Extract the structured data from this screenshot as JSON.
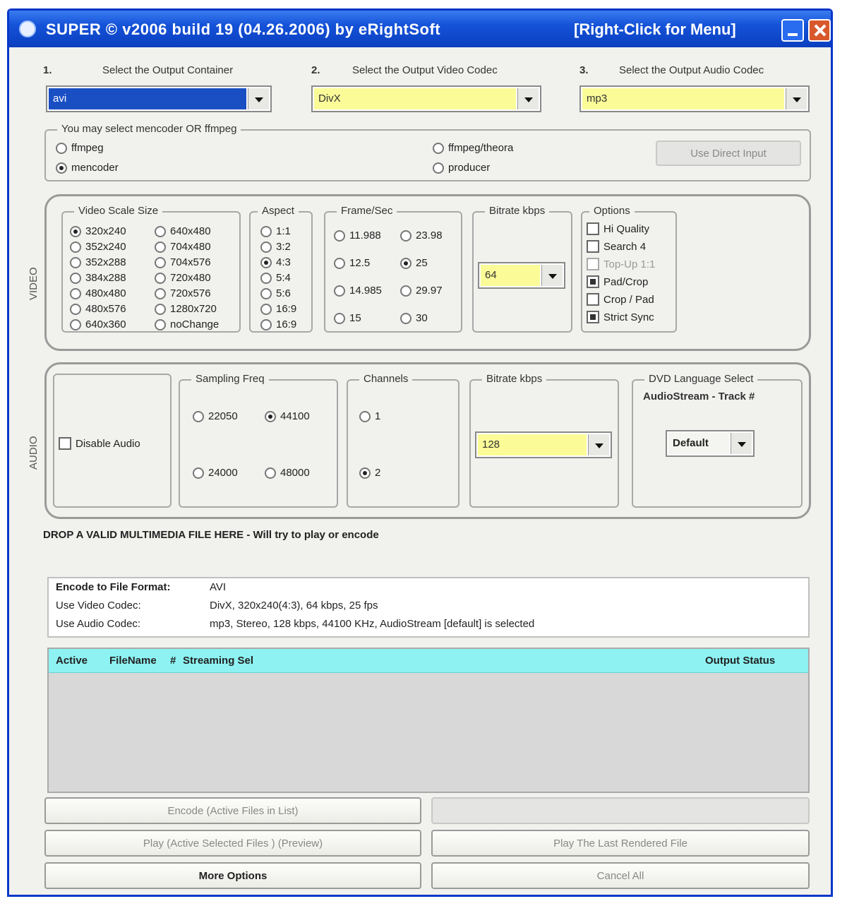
{
  "window": {
    "title": "SUPER © v2006 build 19 (04.26.2006) by eRightSoft",
    "menu_hint": "[Right-Click for Menu]"
  },
  "selectors": {
    "container": {
      "num": "1.",
      "label": "Select the Output Container",
      "value": "avi"
    },
    "video_codec": {
      "num": "2.",
      "label": "Select the Output Video Codec",
      "value": "DivX"
    },
    "audio_codec": {
      "num": "3.",
      "label": "Select the Output Audio Codec",
      "value": "mp3"
    }
  },
  "encoder": {
    "legend": "You may select mencoder OR ffmpeg",
    "options": [
      "ffmpeg",
      "mencoder",
      "ffmpeg/theora",
      "producer"
    ],
    "selected": "mencoder",
    "direct_button": "Use Direct Input"
  },
  "video": {
    "side_label": "VIDEO",
    "scale": {
      "legend": "Video Scale Size",
      "col1": [
        "320x240",
        "352x240",
        "352x288",
        "384x288",
        "480x480",
        "480x576",
        "640x360"
      ],
      "col2": [
        "640x480",
        "704x480",
        "704x576",
        "720x480",
        "720x576",
        "1280x720",
        "noChange"
      ],
      "selected": "320x240"
    },
    "aspect": {
      "legend": "Aspect",
      "options": [
        "1:1",
        "3:2",
        "4:3",
        "5:4",
        "5:6",
        "16:9",
        "16:9"
      ],
      "selected": "4:3"
    },
    "frame": {
      "legend": "Frame/Sec",
      "col1": [
        "11.988",
        "12.5",
        "14.985",
        "15"
      ],
      "col2": [
        "23.98",
        "25",
        "29.97",
        "30"
      ],
      "selected": "25"
    },
    "bitrate": {
      "legend": "Bitrate kbps",
      "value": "64"
    },
    "options": {
      "legend": "Options",
      "items": [
        "Hi Quality",
        "Search 4",
        "Top-Up 1:1",
        "Pad/Crop",
        "Crop / Pad",
        "Strict Sync"
      ],
      "checked": [
        "Pad/Crop",
        "Strict Sync"
      ],
      "disabled": [
        "Top-Up 1:1"
      ]
    }
  },
  "audio": {
    "side_label": "AUDIO",
    "disable_label": "Disable Audio",
    "sampling": {
      "legend": "Sampling Freq",
      "options": [
        "22050",
        "44100",
        "24000",
        "48000"
      ],
      "selected": "44100"
    },
    "channels": {
      "legend": "Channels",
      "options": [
        "1",
        "2"
      ],
      "selected": "2"
    },
    "bitrate": {
      "legend": "Bitrate kbps",
      "value": "128"
    },
    "dvd": {
      "legend": "DVD Language Select",
      "subtitle": "AudioStream - Track #",
      "value": "Default"
    }
  },
  "drop_hint": "DROP A VALID MULTIMEDIA FILE HERE - Will try to play or encode",
  "summary": {
    "rows": [
      {
        "key": "Encode to File Format:",
        "value": "AVI"
      },
      {
        "key": "Use Video Codec:",
        "value": "DivX,  320x240(4:3),  64 kbps,  25 fps"
      },
      {
        "key": "Use Audio Codec:",
        "value": "mp3,  Stereo,  128 kbps,  44100 KHz,  AudioStream [default] is selected"
      }
    ]
  },
  "file_list": {
    "columns": [
      "Active",
      "FileName",
      "#",
      "Streaming Sel",
      "Output Status"
    ]
  },
  "buttons": {
    "encode": "Encode (Active Files in List)",
    "play_active": "Play (Active Selected Files ) (Preview)",
    "play_rendered": "Play The Last Rendered File",
    "more_options": "More Options",
    "cancel": "Cancel All"
  },
  "colors": {
    "title_bar": "#0b3fbf",
    "selected_combo": "#1a4fc4",
    "combo_highlight": "#fbfb98",
    "list_header": "#8ef2f2"
  }
}
